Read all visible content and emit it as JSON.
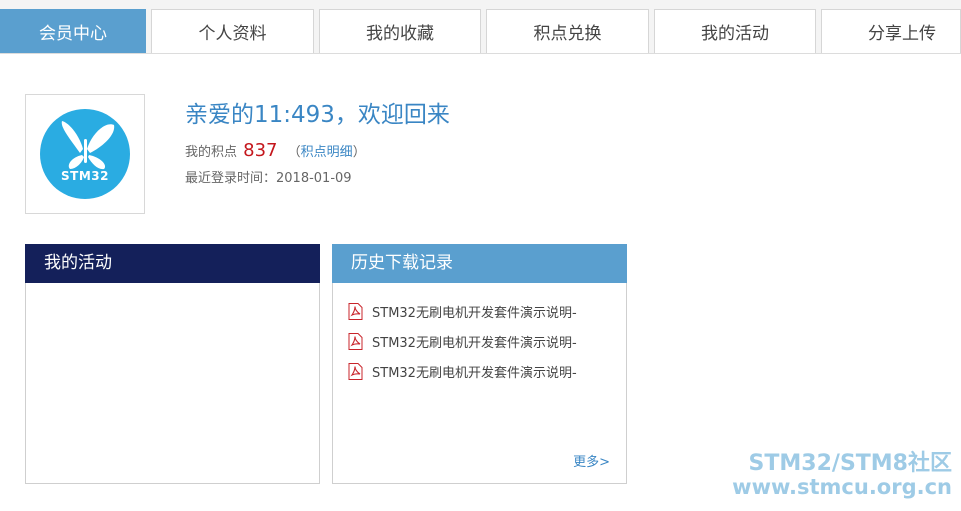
{
  "tabs": [
    {
      "label": "会员中心",
      "active": true
    },
    {
      "label": "个人资料",
      "active": false
    },
    {
      "label": "我的收藏",
      "active": false
    },
    {
      "label": "积点兑换",
      "active": false
    },
    {
      "label": "我的活动",
      "active": false
    },
    {
      "label": "分享上传",
      "active": false
    }
  ],
  "profile": {
    "avatar_text": "STM32",
    "welcome": "亲爱的11:493，欢迎回来",
    "points_label": "我的积点",
    "points_value": "837",
    "points_detail_open": "（",
    "points_detail_link": "积点明细",
    "points_detail_close": "）",
    "last_login": "最近登录时间：2018-01-09"
  },
  "activity_panel": {
    "title": "我的活动"
  },
  "history_panel": {
    "title": "历史下载记录",
    "items": [
      {
        "name": "STM32无刷电机开发套件演示说明-",
        "icon": "pdf-icon"
      },
      {
        "name": "STM32无刷电机开发套件演示说明-",
        "icon": "pdf-icon"
      },
      {
        "name": "STM32无刷电机开发套件演示说明-",
        "icon": "pdf-icon"
      }
    ],
    "more": "更多>"
  },
  "watermark": {
    "line1": "STM32/STM8社区",
    "line2": "www.stmcu.org.cn"
  },
  "colors": {
    "accent": "#5a9fcf",
    "activity_header": "#14205a",
    "points": "#c4161c",
    "link": "#3a86c4"
  }
}
